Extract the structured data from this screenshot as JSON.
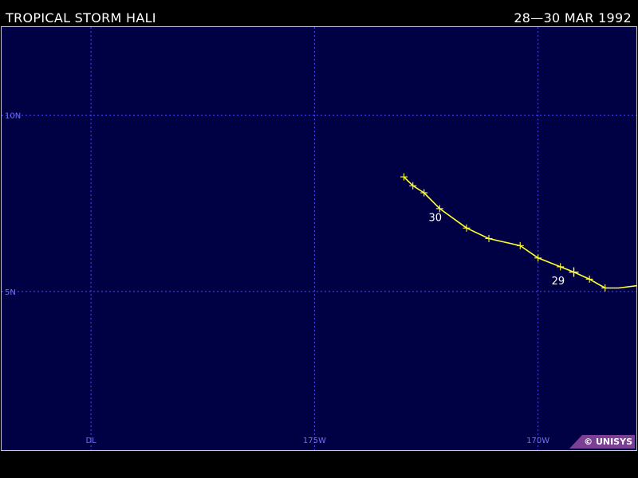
{
  "header": {
    "storm_name": "TROPICAL STORM HALI",
    "date_range": "28—30 MAR 1992"
  },
  "map": {
    "background_color": "#000044",
    "grid_color": "#4a4aff",
    "track_color": "#ffff33",
    "lon_range": [
      -182,
      -167.8
    ],
    "lat_range": [
      0.5,
      12.5
    ],
    "longitude_gridlines": [
      {
        "lon": -180,
        "label": "DL"
      },
      {
        "lon": -175,
        "label": "175W"
      },
      {
        "lon": -170,
        "label": "170W"
      },
      {
        "lon": -165,
        "label": ""
      }
    ],
    "latitude_gridlines": [
      {
        "lat": 10,
        "label": "10N"
      },
      {
        "lat": 5,
        "label": "5N"
      }
    ],
    "track": [
      {
        "lon": -167.55,
        "lat": 5.2,
        "marker": false
      },
      {
        "lon": -168.2,
        "lat": 5.1,
        "marker": false
      },
      {
        "lon": -168.5,
        "lat": 5.1,
        "marker": true
      },
      {
        "lon": -168.85,
        "lat": 5.35,
        "marker": true
      },
      {
        "lon": -169.2,
        "lat": 5.55,
        "marker": true,
        "major": true
      },
      {
        "lon": -169.5,
        "lat": 5.7,
        "marker": true
      },
      {
        "lon": -170.0,
        "lat": 5.95,
        "marker": true
      },
      {
        "lon": -170.4,
        "lat": 6.3,
        "marker": true
      },
      {
        "lon": -171.1,
        "lat": 6.5,
        "marker": true
      },
      {
        "lon": -171.6,
        "lat": 6.8,
        "marker": true
      },
      {
        "lon": -172.2,
        "lat": 7.35,
        "marker": true
      },
      {
        "lon": -172.55,
        "lat": 7.8,
        "marker": true
      },
      {
        "lon": -172.8,
        "lat": 8.0,
        "marker": true
      },
      {
        "lon": -173.0,
        "lat": 8.25,
        "marker": true
      }
    ],
    "day_labels": [
      {
        "text": "30",
        "lon": -172.3,
        "lat": 7.0
      },
      {
        "text": "29",
        "lon": -169.55,
        "lat": 5.2
      }
    ]
  },
  "credit": {
    "text": "© UNISYS"
  }
}
